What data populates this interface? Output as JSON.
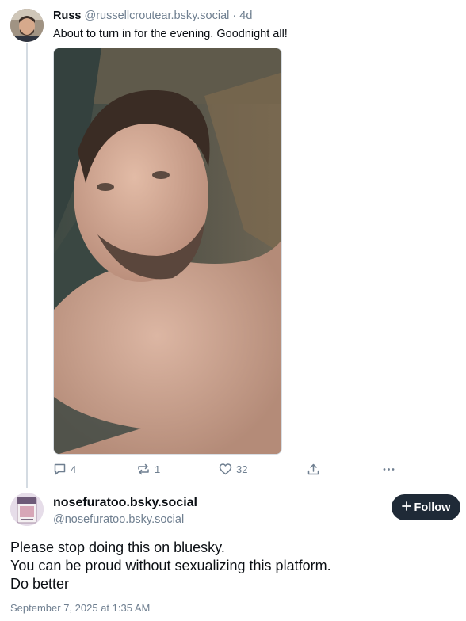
{
  "parent_post": {
    "author_name": "Russ",
    "author_handle": "@russellcroutear.bsky.social",
    "separator": "·",
    "age": "4d",
    "text": "About to turn in for the evening. Goodnight all!",
    "image_icon": "photo-selfie",
    "actions": {
      "reply_count": "4",
      "repost_count": "1",
      "like_count": "32"
    }
  },
  "reply_post": {
    "author_name": "nosefuratoo.bsky.social",
    "author_handle": "@nosefuratoo.bsky.social",
    "follow_label": "Follow",
    "body_lines": [
      "Please stop doing this on bluesky.",
      "You can be proud without sexualizing this platform.",
      "Do better"
    ],
    "timestamp": "September 7, 2025 at 1:35 AM"
  },
  "colors": {
    "text": "#0b0f14",
    "muted": "#6f7f90",
    "thread_line": "#d4dbe2",
    "follow_button": "#1f2a37"
  }
}
